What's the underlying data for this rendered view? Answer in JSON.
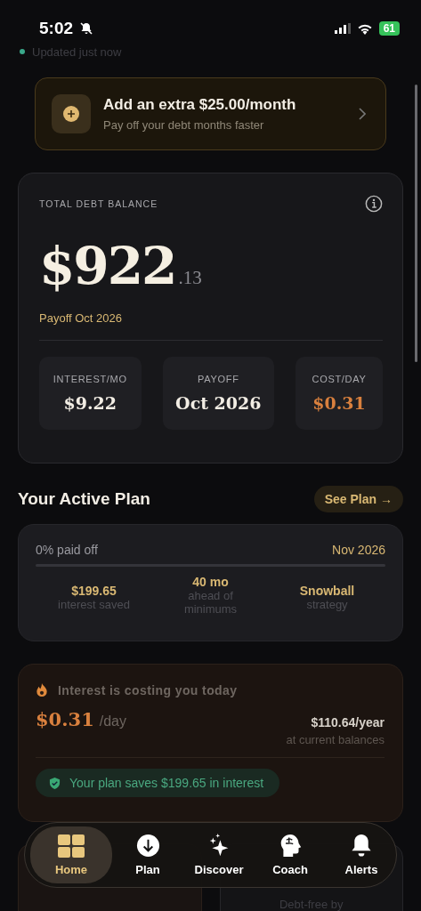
{
  "status_bar": {
    "time": "5:02",
    "battery": "61"
  },
  "update_note": "Updated just now",
  "promo": {
    "title": "Add an extra $25.00/month",
    "subtitle": "Pay off your debt months faster"
  },
  "balance": {
    "label": "TOTAL DEBT BALANCE",
    "amount": "$922",
    "cents": ".13",
    "payoff": "Payoff Oct 2026",
    "stats": [
      {
        "label": "INTEREST/MO",
        "value": "$9.22",
        "kind": "normal"
      },
      {
        "label": "PAYOFF",
        "value": "Oct 2026",
        "kind": "normal"
      },
      {
        "label": "COST/DAY",
        "value": "$0.31",
        "kind": "accent"
      }
    ]
  },
  "plan": {
    "heading": "Your Active Plan",
    "button": "See Plan →",
    "progress_label": "0% paid off",
    "level": 0,
    "date": "Nov 2026",
    "stats": [
      {
        "value": "$199.65",
        "caption": "interest saved"
      },
      {
        "value": "40 mo",
        "caption": "ahead of minimums"
      },
      {
        "value": "Snowball",
        "caption": "strategy"
      }
    ]
  },
  "interest": {
    "title": "Interest is costing you today",
    "amount": "$0.31",
    "unit": "/day",
    "yearly": "$110.64/year",
    "yearly_caption": "at current balances",
    "savings": "Your plan saves $199.65 in interest"
  },
  "peek": {
    "caption": "Debt-free by"
  },
  "nav": {
    "items": [
      {
        "label": "Home",
        "selected": true
      },
      {
        "label": "Plan",
        "selected": false
      },
      {
        "label": "Discover",
        "selected": false
      },
      {
        "label": "Coach",
        "selected": false
      },
      {
        "label": "Alerts",
        "selected": false
      }
    ]
  }
}
